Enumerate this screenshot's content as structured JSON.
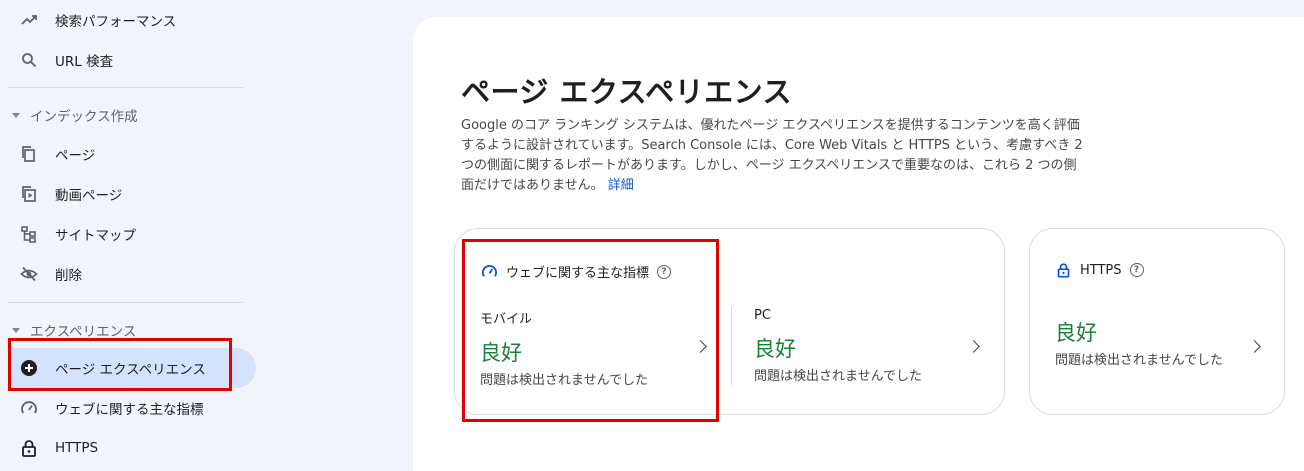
{
  "sidebar": {
    "items": [
      {
        "label": "検索パフォーマンス",
        "icon": "trending-up-icon"
      },
      {
        "label": "URL 検査",
        "icon": "search-icon"
      }
    ],
    "index_section": {
      "title": "インデックス作成",
      "items": [
        {
          "label": "ページ",
          "icon": "pages-icon"
        },
        {
          "label": "動画ページ",
          "icon": "video-pages-icon"
        },
        {
          "label": "サイトマップ",
          "icon": "sitemap-icon"
        },
        {
          "label": "削除",
          "icon": "removals-icon"
        }
      ]
    },
    "experience_section": {
      "title": "エクスペリエンス",
      "items": [
        {
          "label": "ページ エクスペリエンス",
          "icon": "page-experience-icon",
          "active": true
        },
        {
          "label": "ウェブに関する主な指標",
          "icon": "speed-gauge-icon"
        },
        {
          "label": "HTTPS",
          "icon": "lock-icon"
        }
      ]
    }
  },
  "main": {
    "title": "ページ エクスペリエンス",
    "description": "Google のコア ランキング システムは、優れたページ エクスペリエンスを提供するコンテンツを高く評価するように設計されています。Search Console には、Core Web Vitals と HTTPS という、考慮すべき 2 つの側面に関するレポートがあります。しかし、ページ エクスペリエンスで重要なのは、これら 2 つの側面だけではありません。",
    "learn_more": "詳細",
    "cwv_card": {
      "title": "ウェブに関する主な指標",
      "mobile": {
        "label": "モバイル",
        "status": "良好",
        "detail": "問題は検出されませんでした"
      },
      "pc": {
        "label": "PC",
        "status": "良好",
        "detail": "問題は検出されませんでした"
      }
    },
    "https_card": {
      "title": "HTTPS",
      "status": "良好",
      "detail": "問題は検出されませんでした"
    }
  },
  "colors": {
    "sidebar_bg": "#f1f5fb",
    "active_bg": "#d3e3fd",
    "good_green": "#188038",
    "link_blue": "#0b57d0",
    "highlight_red": "#e00000"
  }
}
